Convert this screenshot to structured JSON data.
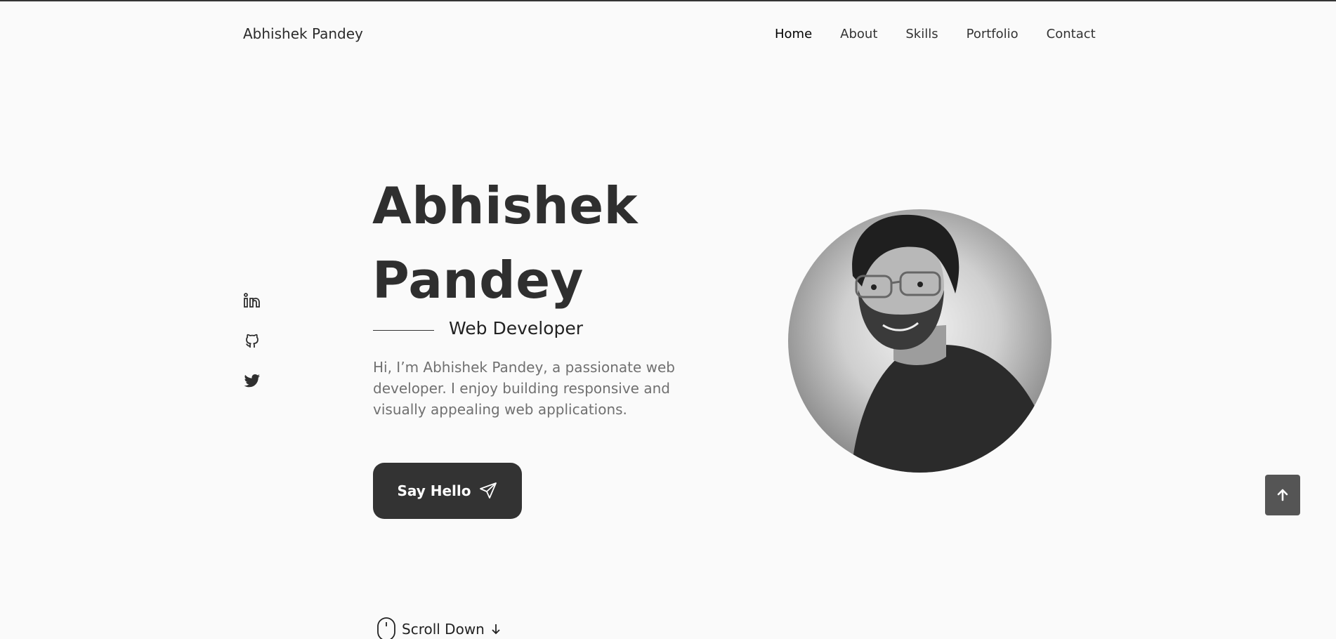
{
  "header": {
    "logo": "Abhishek Pandey",
    "nav": [
      {
        "label": "Home",
        "active": true
      },
      {
        "label": "About",
        "active": false
      },
      {
        "label": "Skills",
        "active": false
      },
      {
        "label": "Portfolio",
        "active": false
      },
      {
        "label": "Contact",
        "active": false
      }
    ]
  },
  "social": [
    "linkedin-icon",
    "github-icon",
    "twitter-icon"
  ],
  "hero": {
    "name_line1": "Abhishek",
    "name_line2": "Pandey",
    "subtitle": "Web Developer",
    "description": "Hi, I’m Abhishek Pandey, a passionate web developer. I enjoy building responsive and visually appealing web applications.",
    "cta_label": "Say Hello",
    "scroll_label": "Scroll Down"
  },
  "colors": {
    "background": "#fafafa",
    "text": "#2f2f2f",
    "muted": "#707070",
    "button": "#333333",
    "to_top": "#555555"
  }
}
